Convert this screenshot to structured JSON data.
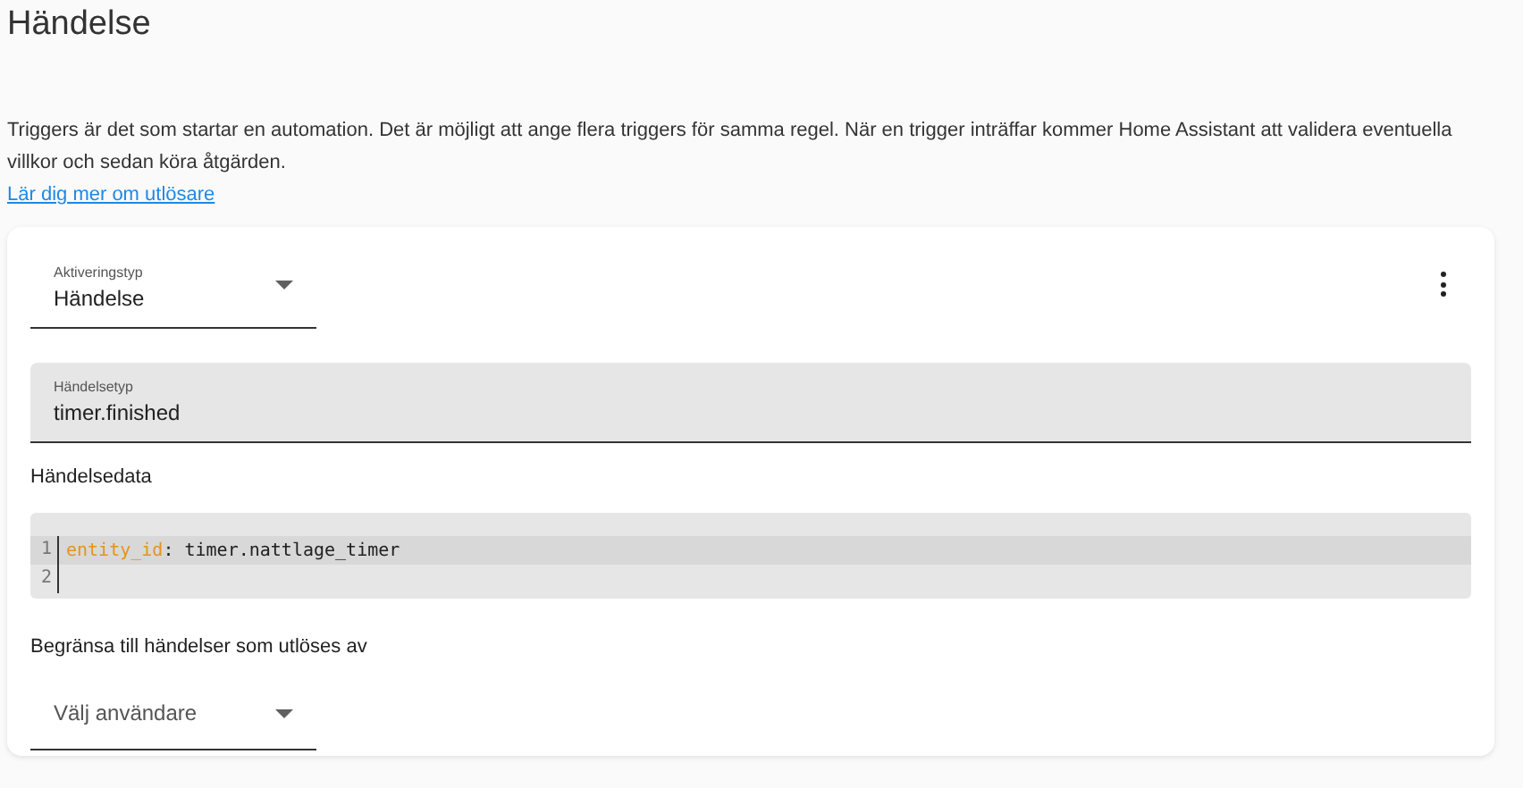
{
  "title": "Händelse",
  "description": "Triggers är det som startar en automation. Det är möjligt att ange flera triggers för samma regel. När en trigger inträffar kommer Home Assistant att validera eventuella villkor och sedan köra åtgärden.",
  "learn_more_link": "Lär dig mer om utlösare",
  "card": {
    "trigger_type": {
      "label": "Aktiveringstyp",
      "value": "Händelse"
    },
    "event_type": {
      "label": "Händelsetyp",
      "value": "timer.finished"
    },
    "event_data_label": "Händelsedata",
    "code_lines": [
      {
        "number": "1",
        "key": "entity_id",
        "separator": ":",
        "value": "timer.nattlage_timer",
        "active": true
      },
      {
        "number": "2",
        "active": false
      }
    ],
    "limit_label": "Begränsa till händelser som utlöses av",
    "user_select": {
      "placeholder": "Välj användare"
    }
  }
}
